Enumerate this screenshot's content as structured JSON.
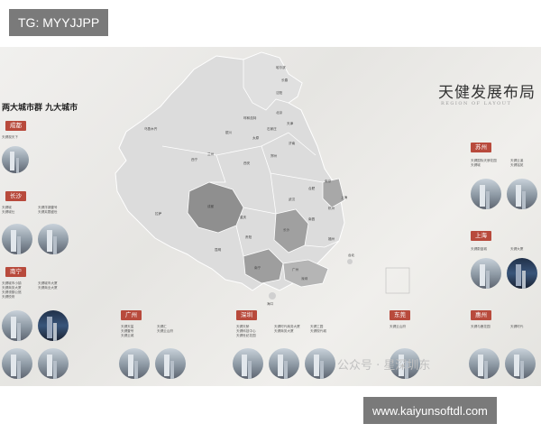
{
  "overlay": {
    "tg_text": "TG: MYYJJPP",
    "url_text": "www.kaiyunsoftdl.com"
  },
  "header": {
    "left_title": "两大城市群 九大城市",
    "main_title": "天健发展布局",
    "main_subtitle": "REGION OF LAYOUT"
  },
  "left_cities": [
    {
      "name": "成都",
      "items": [
        "天健观天下"
      ]
    },
    {
      "name": "长沙",
      "items": [
        "天健城",
        "天健城仕",
        "天健洋湖壹号",
        "天健芙蓉盛世"
      ]
    },
    {
      "name": "南宁",
      "items": [
        "天健城市小镇",
        "天健商务大厦",
        "天健领御公馆",
        "天健悦府",
        "天健城市大厦",
        "天健商业大厦"
      ]
    }
  ],
  "bottom_cities": [
    {
      "name": "广州",
      "items": [
        "天健天玺",
        "天健壹号",
        "天健云城",
        "天健汇",
        "天健云山府"
      ]
    },
    {
      "name": "深圳",
      "items": [
        "天健天骄",
        "天健科技中心",
        "天健世纪花园",
        "天健时代商务大厦",
        "天健商务大厦",
        "天健工园",
        "天健现代城"
      ]
    },
    {
      "name": "东莞",
      "items": [
        "天健云山府"
      ]
    },
    {
      "name": "惠州",
      "items": [
        "天健与鹿花园",
        "天健时代"
      ]
    }
  ],
  "right_cities": [
    {
      "name": "苏州",
      "items": [
        "天健国际天骄花园",
        "天健城",
        "天健云溪",
        "天健铭苑"
      ]
    },
    {
      "name": "上海",
      "items": [
        "天健蔚蓝城",
        "天健大厦"
      ]
    }
  ],
  "map": {
    "labels": [
      "哈尔滨",
      "长春",
      "沈阳",
      "北京",
      "天津",
      "石家庄",
      "太原",
      "济南",
      "郑州",
      "西安",
      "兰州",
      "西宁",
      "银川",
      "呼和浩特",
      "乌鲁木齐",
      "拉萨",
      "成都",
      "重庆",
      "贵阳",
      "昆明",
      "南宁",
      "广州",
      "深圳",
      "长沙",
      "武汉",
      "南昌",
      "合肥",
      "南京",
      "上海",
      "杭州",
      "福州",
      "台北",
      "海口"
    ]
  },
  "watermark": "公众号 · 星深圳东"
}
